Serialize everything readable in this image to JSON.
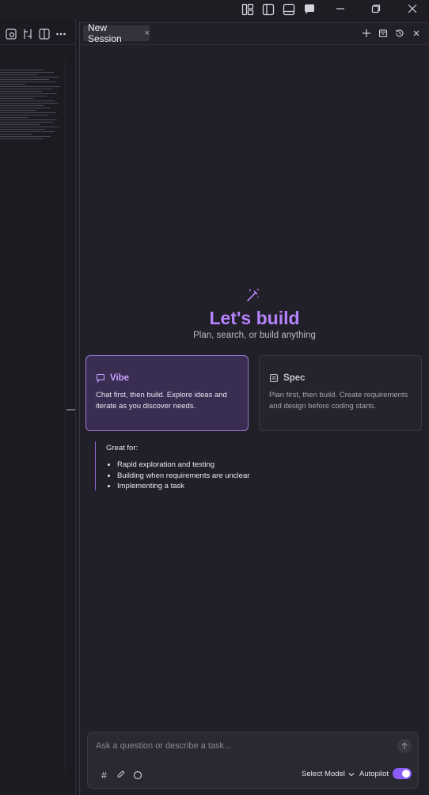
{
  "session": {
    "tab_label": "New Session",
    "tab_close": "×"
  },
  "hero": {
    "title": "Let's build",
    "subtitle": "Plan, search, or build anything"
  },
  "modes": {
    "vibe": {
      "title": "Vibe",
      "description": "Chat first, then build. Explore ideas and iterate as you discover needs."
    },
    "spec": {
      "title": "Spec",
      "description": "Plan first, then build. Create requirements and design before coding starts."
    }
  },
  "great_for": {
    "title": "Great for:",
    "items": [
      "Rapid exploration and testing",
      "Building when requirements are unclear",
      "Implementing a task"
    ]
  },
  "composer": {
    "placeholder": "Ask a question or describe a task...",
    "hash_symbol": "#",
    "model_label": "Select Model",
    "autopilot_label": "Autopilot",
    "autopilot_on": true
  },
  "colors": {
    "accent": "#b683ff",
    "toggle": "#8b5cf6",
    "background": "#1f1d24"
  }
}
